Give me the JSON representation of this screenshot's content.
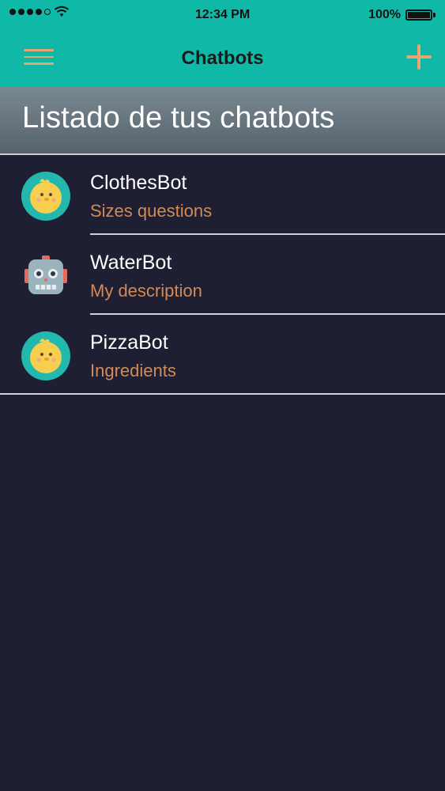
{
  "status_bar": {
    "time": "12:34 PM",
    "battery": "100%"
  },
  "nav": {
    "title": "Chatbots",
    "menu_icon": "hamburger-icon",
    "add_icon": "plus-icon"
  },
  "heading": "Listado de tus chatbots",
  "colors": {
    "teal": "#10b8a8",
    "accent": "#e7a66f",
    "description": "#d38a55",
    "background": "#1f1f33"
  },
  "bots": [
    {
      "name": "ClothesBot",
      "description": "Sizes questions",
      "avatar": "chick-avatar"
    },
    {
      "name": "WaterBot",
      "description": "My description",
      "avatar": "robot-avatar"
    },
    {
      "name": "PizzaBot",
      "description": "Ingredients",
      "avatar": "chick-avatar"
    }
  ]
}
